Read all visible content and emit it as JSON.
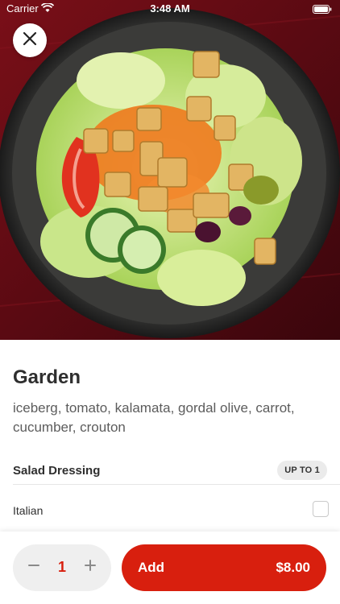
{
  "status_bar": {
    "carrier": "Carrier",
    "time": "3:48 AM"
  },
  "hero": {
    "image_subject": "garden-salad-photo",
    "close_icon": "close-icon"
  },
  "item": {
    "title": "Garden",
    "description": "iceberg, tomato, kalamata, gordal olive, carrot, cucumber, crouton"
  },
  "modifier_group": {
    "title": "Salad Dressing",
    "badge": "UP TO 1",
    "options": [
      {
        "label": "Italian",
        "checked": false
      }
    ]
  },
  "cart_bar": {
    "quantity": "1",
    "add_label": "Add",
    "price": "$8.00",
    "minus_icon": "minus-icon",
    "plus_icon": "plus-icon"
  },
  "colors": {
    "accent": "#d81f0e",
    "stepper_bg": "#efefef",
    "badge_bg": "#ebebeb"
  }
}
